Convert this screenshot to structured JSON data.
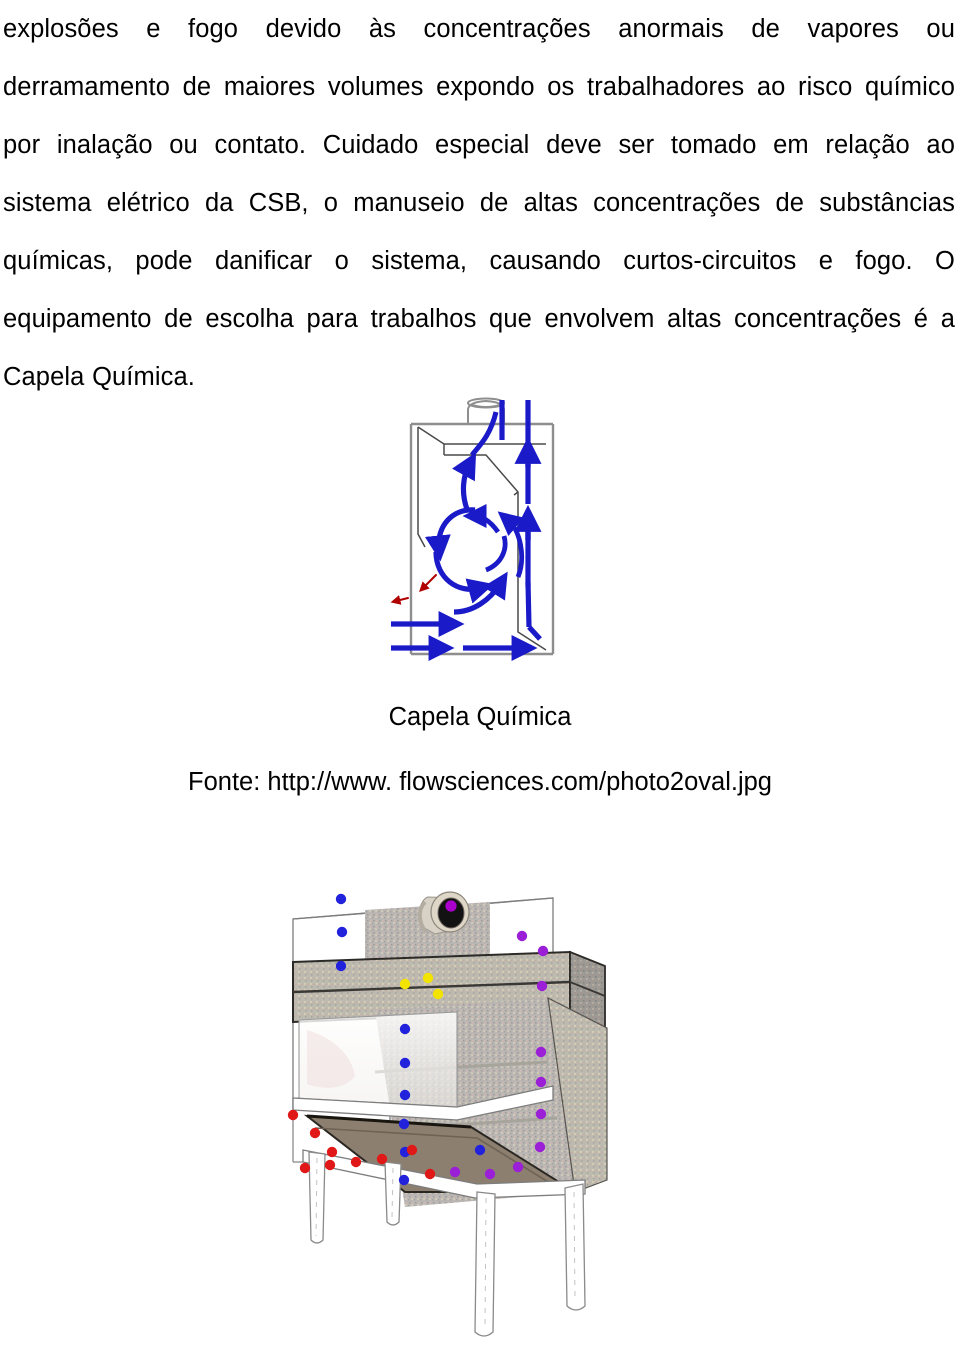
{
  "document": {
    "paragraph": {
      "full_text": "explosões e fogo devido às concentrações anormais de vapores ou derramamento de maiores volumes expondo os trabalhadores ao risco químico por inalação ou contato. Cuidado especial deve ser tomado em relação ao sistema elétrico da CSB, o manuseio de altas concentrações de substâncias químicas, pode danificar o sistema, causando curtos-circuitos e fogo. O equipamento de escolha para trabalhos que envolvem altas concentrações é a Capela Química.",
      "lines": [
        "explosões e fogo devido às concentrações anormais de vapores ou",
        "derramamento de maiores volumes expondo os trabalhadores ao risco químico",
        "por inalação ou contato. Cuidado especial deve ser tomado em relação ao",
        "sistema elétrico da CSB, o manuseio de altas concentrações de substâncias",
        "químicas, pode danificar o sistema, causando curtos-circuitos e fogo. O",
        "equipamento de escolha para trabalhos que envolvem altas concentrações é a",
        "Capela Química."
      ]
    },
    "figure_airflow": {
      "name": "capela-quimica-fluxo-de-ar",
      "alt": "Corte esquemático de capela química mostrando o fluxo de ar com setas azuis e escape de contaminante em vermelho",
      "arrow_color": "#1a1ac8",
      "leak_color": "#b00000",
      "outline_color": "#9a9a9a"
    },
    "figure_hood": {
      "name": "capela-quimica-perspectiva",
      "alt": "Desenho em perspectiva de uma capela química com partículas coloridas representando vapores",
      "particle_colors": {
        "blue": "#2222dd",
        "purple": "#9b1fd6",
        "yellow": "#f2e400",
        "red": "#e01818",
        "magenta": "#aa00cc"
      },
      "body_color": "#b0adac",
      "outline_color": "#6b6b6b"
    },
    "caption": {
      "title": "Capela Química",
      "source": "Fonte: http://www. flowsciences.com/photo2oval.jpg"
    }
  }
}
